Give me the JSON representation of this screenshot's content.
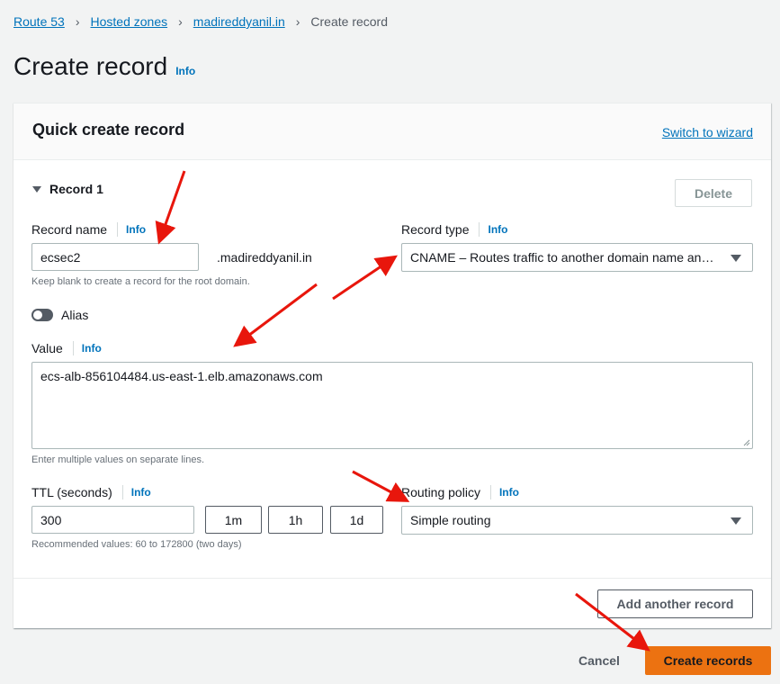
{
  "breadcrumb": {
    "items": [
      "Route 53",
      "Hosted zones",
      "madireddyanil.in"
    ],
    "current": "Create record"
  },
  "page": {
    "title": "Create record",
    "info": "Info"
  },
  "card": {
    "title": "Quick create record",
    "switch_to_wizard": "Switch to wizard"
  },
  "record": {
    "toggle_label": "Record 1",
    "delete_label": "Delete",
    "name": {
      "label": "Record name",
      "info": "Info",
      "value": "ecsec2",
      "suffix": ".madireddyanil.in",
      "hint": "Keep blank to create a record for the root domain."
    },
    "type": {
      "label": "Record type",
      "info": "Info",
      "selected": "CNAME – Routes traffic to another domain name and to some AWS resources"
    },
    "alias": {
      "label": "Alias",
      "enabled": false
    },
    "value": {
      "label": "Value",
      "info": "Info",
      "text": "ecs-alb-856104484.us-east-1.elb.amazonaws.com",
      "hint": "Enter multiple values on separate lines."
    },
    "ttl": {
      "label": "TTL (seconds)",
      "info": "Info",
      "value": "300",
      "presets": [
        "1m",
        "1h",
        "1d"
      ],
      "hint": "Recommended values: 60 to 172800 (two days)"
    },
    "routing": {
      "label": "Routing policy",
      "info": "Info",
      "selected": "Simple routing"
    }
  },
  "actions": {
    "add_another": "Add another record",
    "cancel": "Cancel",
    "create": "Create records"
  },
  "colors": {
    "link": "#0073bb",
    "primary": "#ec7211",
    "annotation_arrow": "#e8160c"
  }
}
